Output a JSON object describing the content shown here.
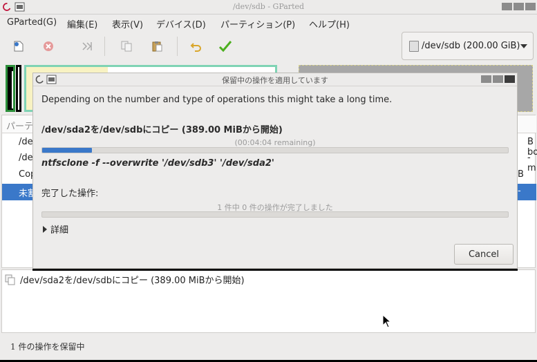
{
  "window": {
    "title": "/dev/sdb - GParted"
  },
  "menubar": {
    "items": [
      "GParted(G)",
      "編集(E)",
      "表示(V)",
      "デバイス(D)",
      "パーティション(P)",
      "ヘルプ(H)"
    ]
  },
  "toolbar": {
    "buttons": [
      "new-icon",
      "delete-icon",
      "resize-move-icon",
      "copy-icon",
      "paste-icon",
      "undo-icon",
      "apply-icon"
    ]
  },
  "device_selector": {
    "label": "/dev/sdb (200.00 GiB)"
  },
  "partition_list": {
    "header_first": "パーテ",
    "rows": [
      {
        "left": "/dev",
        "right": "B  bo"
      },
      {
        "left": "/dev",
        "right": "-  m"
      },
      {
        "left": "Cop",
        "right": "B"
      },
      {
        "left": "未割",
        "right": "-"
      }
    ]
  },
  "pending_ops": {
    "items": [
      "/dev/sda2を/dev/sdbにコピー (389.00 MiBから開始)"
    ]
  },
  "statusbar": {
    "text": "1 件の操作を保留中"
  },
  "dialog": {
    "title": "保留中の操作を適用しています",
    "intro": "Depending on the number and type of operations this might take a long time.",
    "current_op": "/dev/sda2を/dev/sdbにコピー (389.00 MiBから開始)",
    "remaining": "(00:04:04 remaining)",
    "current_progress": 0.107,
    "command": "ntfsclone -f --overwrite '/dev/sdb3' '/dev/sda2'",
    "completed_label": "完了した操作:",
    "completed_text": "1 件中 0 件の操作が完了しました",
    "completed_progress": 0.0,
    "details_label": "詳細",
    "cancel_label": "Cancel"
  },
  "colors": {
    "accent": "#3a78c9",
    "ntfs_border": "#7fd3b4",
    "unallocated": "#a7a7a7"
  }
}
